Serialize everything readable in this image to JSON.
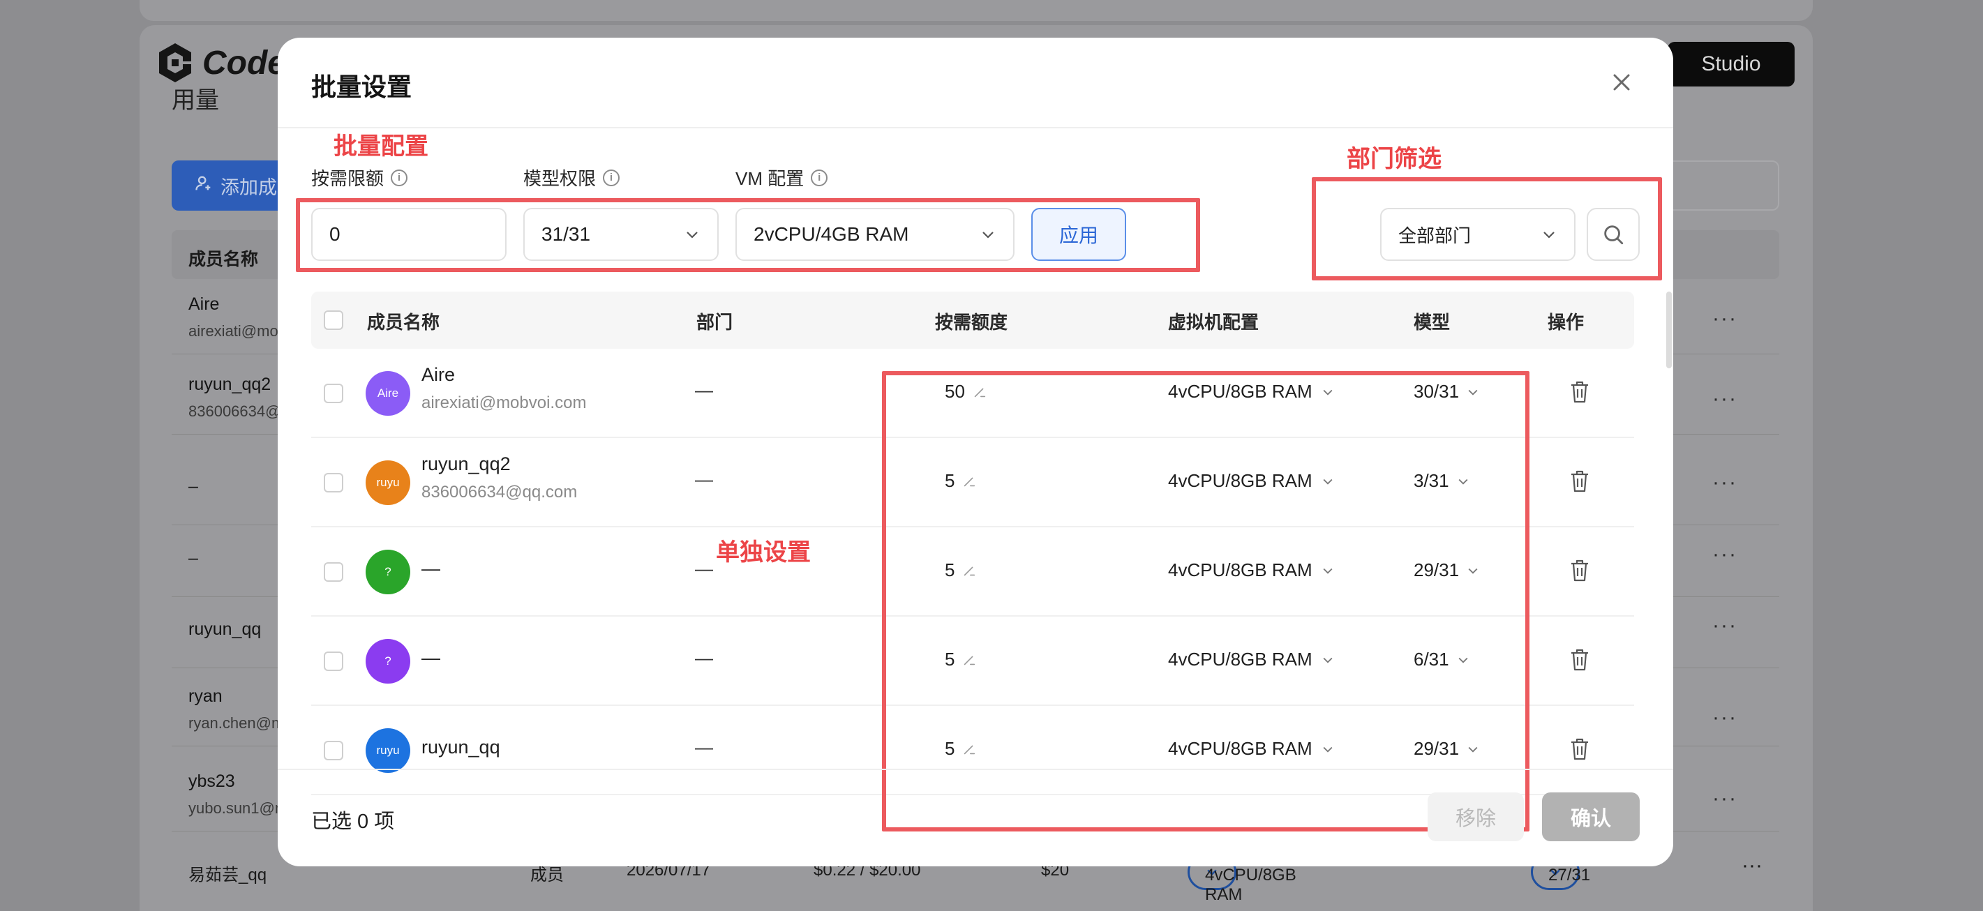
{
  "background": {
    "logo_text": "Code",
    "studio_button": "Studio",
    "add_member_button": "添加成",
    "section_title": "用量",
    "table_header_name": "成员名称",
    "rows": [
      {
        "name": "Aire",
        "email": "airexiati@mo"
      },
      {
        "name": "ruyun_qq2",
        "email": "836006634@"
      },
      {
        "name": "–",
        "email": ""
      },
      {
        "name": "–",
        "email": ""
      },
      {
        "name": "ruyun_qq",
        "email": ""
      },
      {
        "name": "ryan",
        "email": "ryan.chen@m"
      },
      {
        "name": "ybs23",
        "email": "yubo.sun1@m"
      }
    ],
    "row_menu": "···",
    "last_row": {
      "name": "易茹芸_qq",
      "role": "成员",
      "date": "2026/07/17",
      "usage": "$0.22 / $20.00",
      "quota": "$20",
      "vm": "4vCPU/8GB RAM",
      "model": "27/31"
    }
  },
  "modal": {
    "title": "批量设置",
    "annotations": {
      "batch_config": "批量配置",
      "dept_filter": "部门筛选",
      "individual": "单独设置"
    },
    "batch": {
      "quota_label": "按需限额",
      "model_label": "模型权限",
      "vm_label": "VM 配置",
      "quota_value": "0",
      "model_value": "31/31",
      "vm_value": "2vCPU/4GB RAM",
      "apply_button": "应用"
    },
    "dept_select": "全部部门",
    "table": {
      "headers": {
        "name": "成员名称",
        "dept": "部门",
        "quota": "按需额度",
        "vm": "虚拟机配置",
        "model": "模型",
        "action": "操作"
      },
      "rows": [
        {
          "avatar": "Aire",
          "avatar_color": "#8b5cf6",
          "name": "Aire",
          "email": "airexiati@mobvoi.com",
          "dept": "—",
          "quota": "50",
          "vm": "4vCPU/8GB RAM",
          "model": "30/31"
        },
        {
          "avatar": "ruyu",
          "avatar_color": "#e8821a",
          "name": "ruyun_qq2",
          "email": "836006634@qq.com",
          "dept": "—",
          "quota": "5",
          "vm": "4vCPU/8GB RAM",
          "model": "3/31"
        },
        {
          "avatar": "?",
          "avatar_color": "#2aa52a",
          "name": "—",
          "email": "",
          "dept": "—",
          "quota": "5",
          "vm": "4vCPU/8GB RAM",
          "model": "29/31"
        },
        {
          "avatar": "?",
          "avatar_color": "#8b3cf0",
          "name": "—",
          "email": "",
          "dept": "—",
          "quota": "5",
          "vm": "4vCPU/8GB RAM",
          "model": "6/31"
        },
        {
          "avatar": "ruyu",
          "avatar_color": "#1d73e0",
          "name": "ruyun_qq",
          "email": "",
          "dept": "—",
          "quota": "5",
          "vm": "4vCPU/8GB RAM",
          "model": "29/31"
        }
      ]
    },
    "footer": {
      "selected_text": "已选 0 项",
      "remove_button": "移除",
      "confirm_button": "确认"
    }
  }
}
